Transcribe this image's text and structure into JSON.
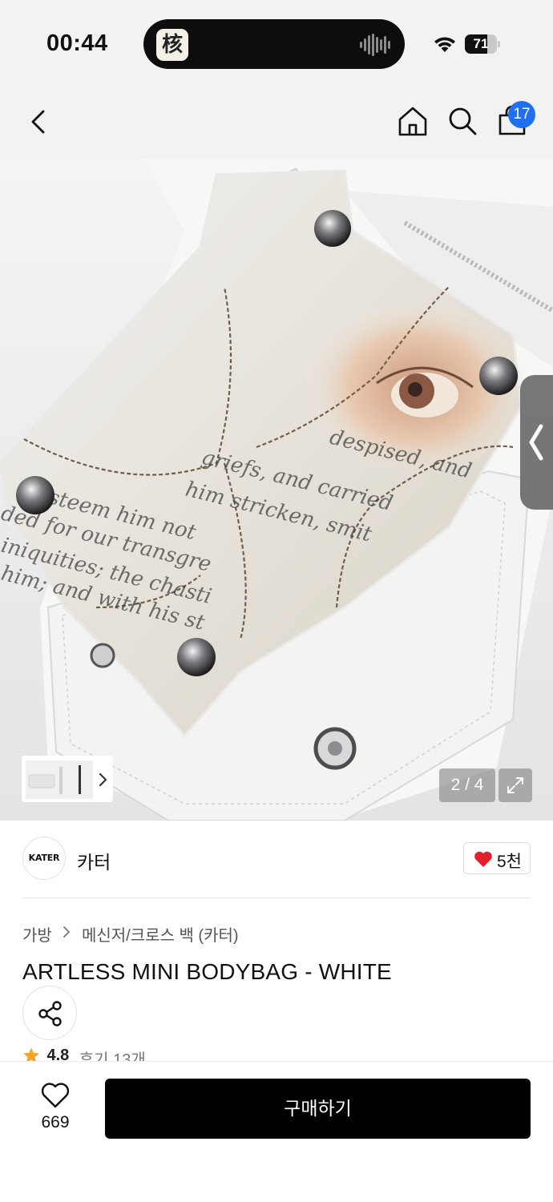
{
  "status_bar": {
    "time": "00:44",
    "island_app_glyph": "核",
    "battery_percent": 71,
    "battery_label": "71"
  },
  "nav": {
    "icons": [
      "back-chevron-icon",
      "home-icon",
      "search-icon",
      "shopping-bag-icon"
    ],
    "cart_badge": "17"
  },
  "gallery": {
    "page_indicator": "2 / 4",
    "current_page": 2,
    "total_pages": 4
  },
  "brand": {
    "logo_text": "KATER",
    "name": "카터",
    "likes": "5천"
  },
  "breadcrumb": [
    "가방",
    "메신저/크로스 백 (카터)"
  ],
  "product": {
    "title": "ARTLESS MINI BODYBAG - WHITE"
  },
  "rating": {
    "value": "4.8",
    "reviews": "후기 13개"
  },
  "bottom_bar": {
    "wish_count": "669",
    "buy_label": "구매하기"
  },
  "colors": {
    "accent_blue": "#1f6ff5",
    "heart_red": "#e4202a",
    "star_orange": "#f5a524",
    "buy_button": "#000000"
  }
}
